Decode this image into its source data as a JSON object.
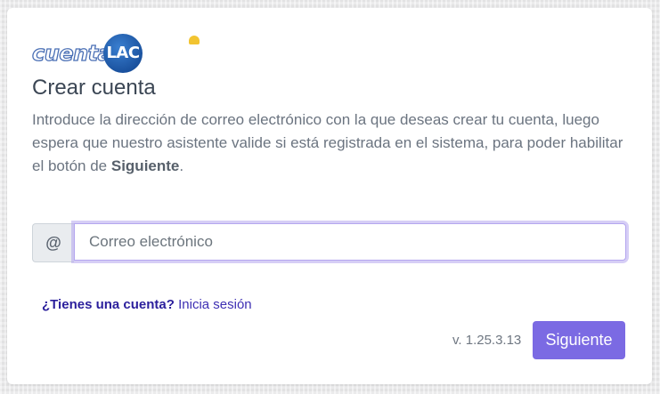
{
  "logo": {
    "text_left": "cuenta",
    "text_right": "LAC"
  },
  "header": {
    "title": "Crear cuenta"
  },
  "description": {
    "text_before": "Introduce la dirección de correo electrónico con la que deseas crear tu cuenta, luego espera que nuestro asistente valide si está registrada en el sistema, para poder habilitar el botón de ",
    "bold": "Siguiente",
    "text_after": "."
  },
  "email": {
    "addon_icon": "at-icon",
    "addon_symbol": "@",
    "placeholder": "Correo electrónico",
    "value": ""
  },
  "account": {
    "question": "¿Tienes una cuenta?",
    "link": "Inicia sesión"
  },
  "footer": {
    "version": "v. 1.25.3.13",
    "next_label": "Siguiente"
  },
  "colors": {
    "accent": "#7b6ae3",
    "link": "#3d2fb3",
    "title": "#3b4654"
  }
}
